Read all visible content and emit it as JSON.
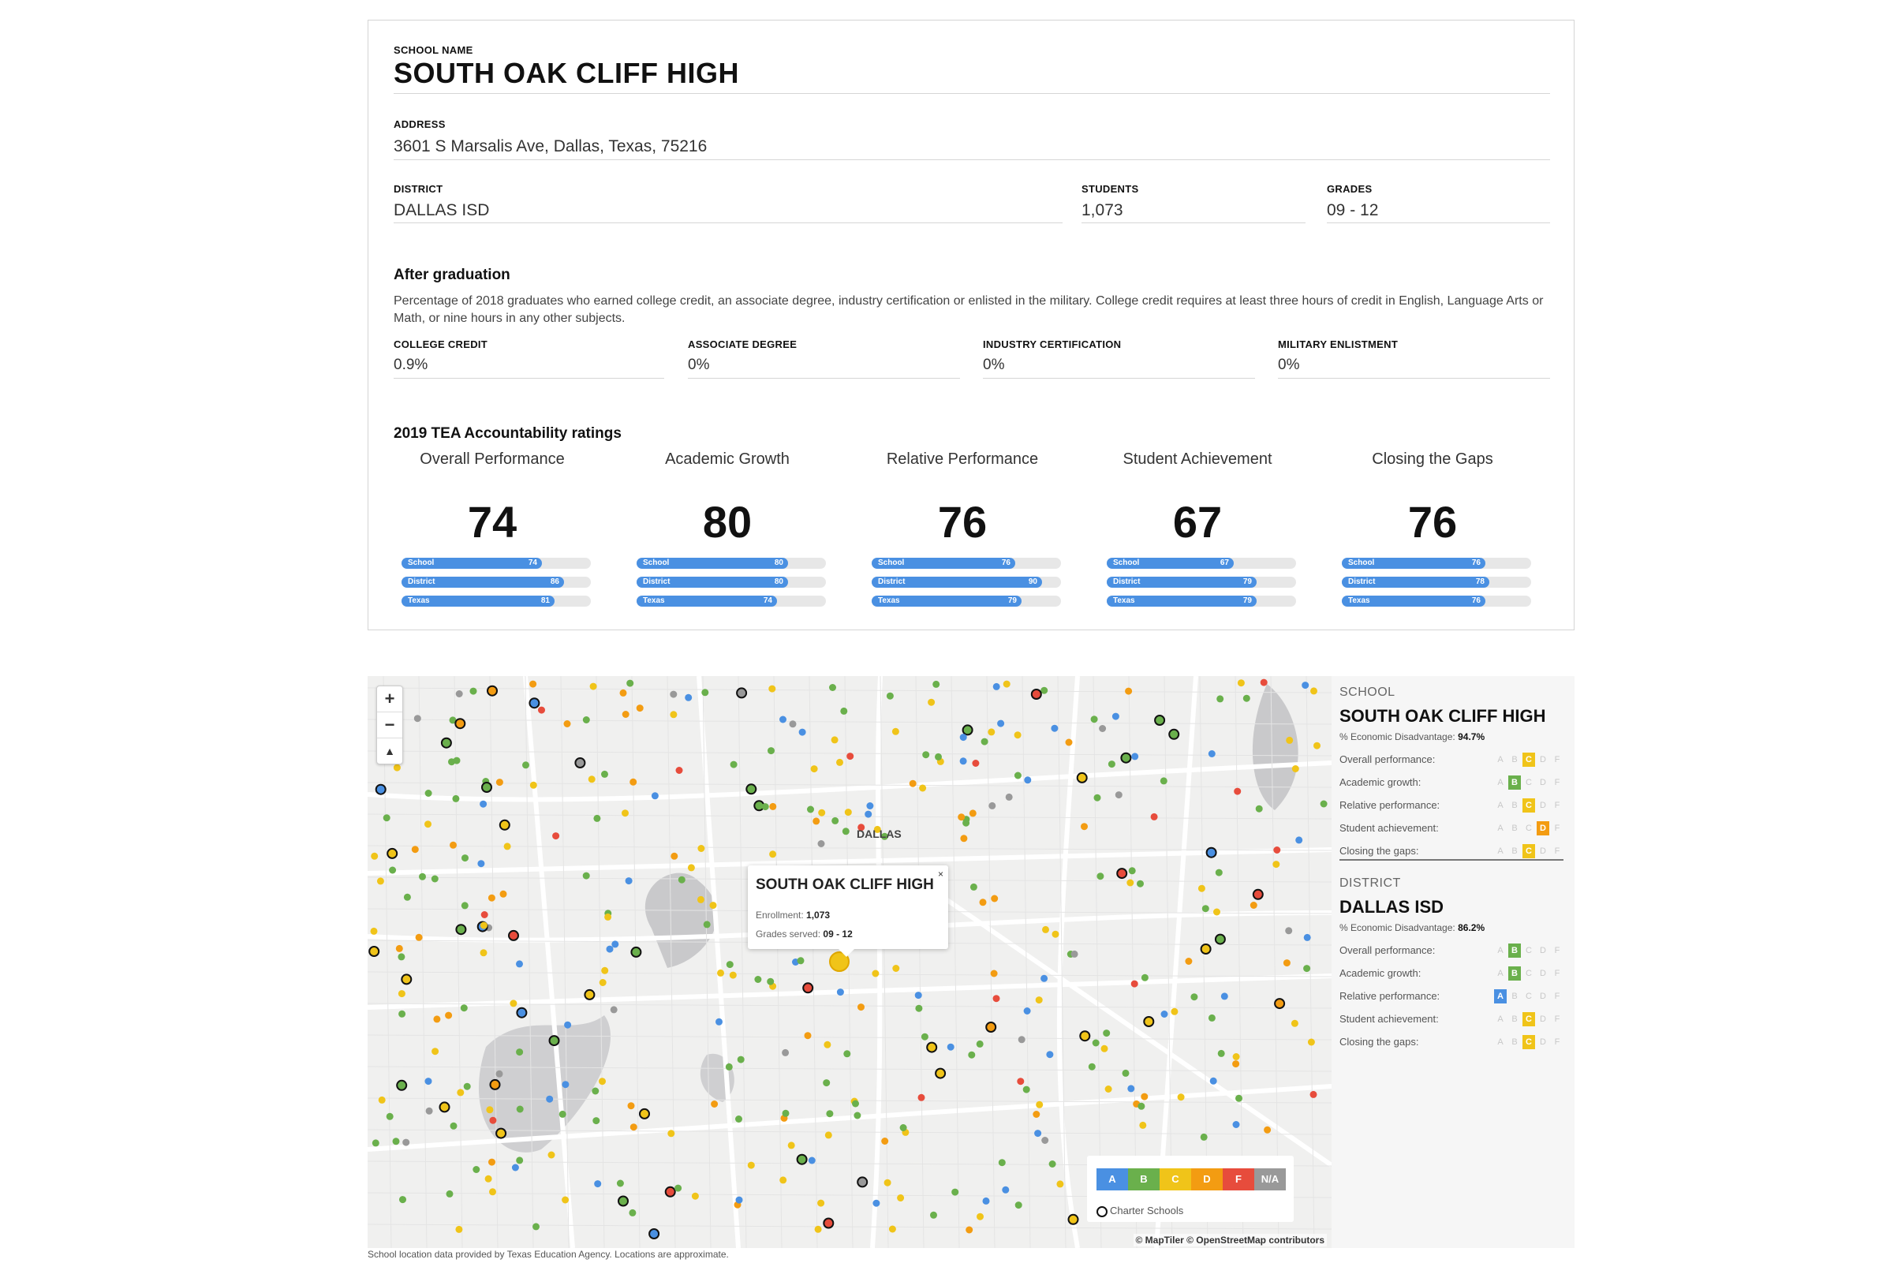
{
  "school": {
    "name_label": "SCHOOL NAME",
    "name": "SOUTH OAK CLIFF HIGH",
    "address_label": "ADDRESS",
    "address": "3601 S Marsalis Ave, Dallas, Texas, 75216",
    "district_label": "DISTRICT",
    "district": "DALLAS ISD",
    "students_label": "STUDENTS",
    "students": "1,073",
    "grades_label": "GRADES",
    "grades": "09 - 12"
  },
  "after_graduation": {
    "title": "After graduation",
    "description": "Percentage of 2018 graduates who earned college credit, an associate degree, industry certification or enlisted in the military. College credit requires at least three hours of credit in English, Language Arts or Math, or nine hours in any other subjects.",
    "stats": [
      {
        "label": "COLLEGE CREDIT",
        "value": "0.9%"
      },
      {
        "label": "ASSOCIATE DEGREE",
        "value": "0%"
      },
      {
        "label": "INDUSTRY CERTIFICATION",
        "value": "0%"
      },
      {
        "label": "MILITARY ENLISTMENT",
        "value": "0%"
      }
    ]
  },
  "ratings": {
    "title": "2019 TEA Accountability ratings",
    "bar_labels": [
      "School",
      "District",
      "Texas"
    ],
    "items": [
      {
        "title": "Overall Performance",
        "score": "74",
        "school": 74,
        "district": 86,
        "texas": 81
      },
      {
        "title": "Academic Growth",
        "score": "80",
        "school": 80,
        "district": 80,
        "texas": 74
      },
      {
        "title": "Relative Performance",
        "score": "76",
        "school": 76,
        "district": 90,
        "texas": 79
      },
      {
        "title": "Student Achievement",
        "score": "67",
        "school": 67,
        "district": 79,
        "texas": 79
      },
      {
        "title": "Closing the Gaps",
        "score": "76",
        "school": 76,
        "district": 78,
        "texas": 76
      }
    ]
  },
  "map": {
    "zoom_in": "+",
    "zoom_out": "−",
    "compass": "▲",
    "city_label": "DALLAS",
    "popup": {
      "title": "SOUTH OAK CLIFF HIGH",
      "enrollment_label": "Enrollment:",
      "enrollment": "1,073",
      "grades_label": "Grades served:",
      "grades": "09 - 12",
      "close": "×"
    },
    "legend": {
      "items": [
        {
          "label": "A",
          "color": "#4a90e2"
        },
        {
          "label": "B",
          "color": "#6ab04c"
        },
        {
          "label": "C",
          "color": "#f0c419"
        },
        {
          "label": "D",
          "color": "#f39c12"
        },
        {
          "label": "F",
          "color": "#e74c3c"
        },
        {
          "label": "N/A",
          "color": "#999999"
        }
      ],
      "charter": "Charter Schools"
    },
    "attribution": "© MapTiler © OpenStreetMap contributors"
  },
  "panel": {
    "school_heading": "SCHOOL",
    "school_name": "SOUTH OAK CLIFF HIGH",
    "school_econ_label": "% Economic Disadvantage:",
    "school_econ": "94.7%",
    "district_heading": "DISTRICT",
    "district_name": "DALLAS ISD",
    "district_econ_label": "% Economic Disadvantage:",
    "district_econ": "86.2%",
    "row_labels": [
      "Overall performance:",
      "Academic growth:",
      "Relative performance:",
      "Student achievement:",
      "Closing the gaps:"
    ],
    "grade_letters": [
      "A",
      "B",
      "C",
      "D",
      "F"
    ],
    "school_grades": [
      "C",
      "B",
      "C",
      "D",
      "C"
    ],
    "district_grades": [
      "B",
      "B",
      "A",
      "C",
      "C"
    ],
    "grade_colors": {
      "A": "#4a90e2",
      "B": "#6ab04c",
      "C": "#f0c419",
      "D": "#f39c12",
      "F": "#e74c3c"
    }
  },
  "footnote": "School location data provided by Texas Education Agency. Locations are approximate."
}
